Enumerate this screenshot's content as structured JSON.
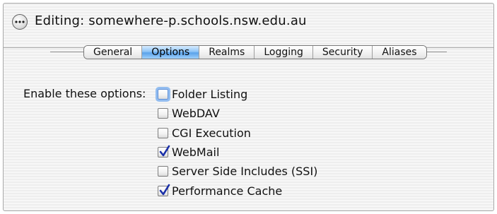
{
  "window": {
    "title": "Editing: somewhere-p.schools.nsw.edu.au",
    "back_icon": "back-ellipsis-icon"
  },
  "tabs": [
    {
      "label": "General",
      "active": false
    },
    {
      "label": "Options",
      "active": true
    },
    {
      "label": "Realms",
      "active": false
    },
    {
      "label": "Logging",
      "active": false
    },
    {
      "label": "Security",
      "active": false
    },
    {
      "label": "Aliases",
      "active": false
    }
  ],
  "options": {
    "label": "Enable these options:",
    "items": [
      {
        "label": "Folder Listing",
        "checked": false,
        "focused": true
      },
      {
        "label": "WebDAV",
        "checked": false,
        "focused": false
      },
      {
        "label": "CGI Execution",
        "checked": false,
        "focused": false
      },
      {
        "label": "WebMail",
        "checked": true,
        "focused": false
      },
      {
        "label": "Server Side Includes (SSI)",
        "checked": false,
        "focused": false
      },
      {
        "label": "Performance Cache",
        "checked": true,
        "focused": false
      }
    ]
  },
  "colors": {
    "active_tab": "#5aa2ea",
    "focus_ring": "#93bdf0",
    "checkmark": "#1a2fa8"
  }
}
